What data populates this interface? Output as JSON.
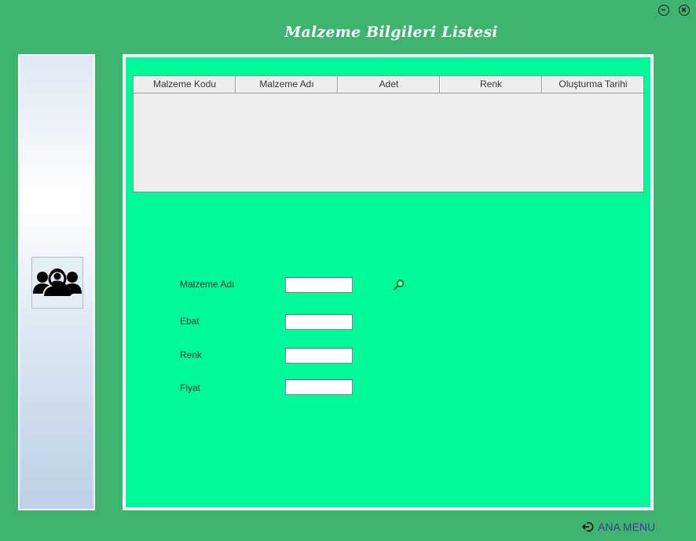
{
  "window": {
    "title": "Malzeme Bilgileri Listesi",
    "minimize_icon": "minimize-icon",
    "close_icon": "close-icon"
  },
  "sidebar": {
    "icon": "user-search-icon"
  },
  "table": {
    "columns": [
      "Malzeme Kodu",
      "Malzeme Adı",
      "Adet",
      "Renk",
      "Oluşturma Tarihi"
    ],
    "rows": []
  },
  "form": {
    "fields": [
      {
        "label": "Malzeme Adı",
        "value": ""
      },
      {
        "label": "Ebat",
        "value": ""
      },
      {
        "label": "Renk",
        "value": ""
      },
      {
        "label": "Fiyat",
        "value": ""
      }
    ],
    "search_icon": "search-icon"
  },
  "footer": {
    "back_label": "ANA MENU",
    "back_icon": "back-arrow-icon"
  },
  "colors": {
    "background": "#3fb370",
    "panel": "#00fa9a",
    "link": "#3a3f8f"
  }
}
